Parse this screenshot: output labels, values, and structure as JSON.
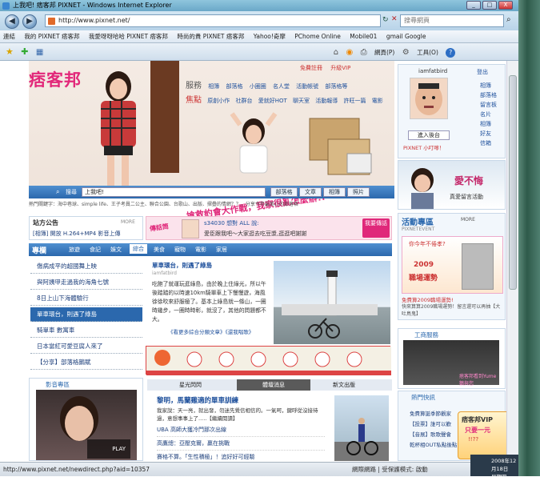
{
  "window": {
    "title": "上我吧! 痞客邦 PIXNET - Windows Internet Explorer",
    "min": "_",
    "max": "□",
    "close": "X"
  },
  "address": {
    "url": "http://www.pixnet.net/",
    "search_placeholder": "搜尋網頁"
  },
  "favorites": [
    "連結",
    "我的 PIXNET 痞客邦",
    "我愛呀呀哈哈 PIXNET 痞客邦",
    "時尚的貴 PIXNET 痞客邦",
    "Yahoo!奇摩",
    "PChome Online",
    "Mobile01",
    "gmail Google"
  ],
  "toolbar": {
    "page": "網頁(P)",
    "tools": "工具(O)",
    "help": "?"
  },
  "header": {
    "logo": "痞客邦",
    "top_links": [
      "免費註冊",
      "升級VIP"
    ],
    "cat1": "服務",
    "cat1_items": [
      "相簿",
      "部落格",
      "小圈圈",
      "名人堂",
      "活動帳號",
      "部落格等"
    ],
    "cat2": "焦點",
    "cat2_items": [
      "原創小作",
      "社群台",
      "愛就好HOT",
      "聊天室",
      "活動報導",
      "許旺一篇",
      "電影"
    ],
    "banner_text": "搶救約會大作戰，我家很亂怎麼辦!!",
    "search_label": "搜尋",
    "search_value": "上我吧!",
    "search_tabs": [
      "部落格",
      "文章",
      "相簿",
      "照片"
    ],
    "hot_keywords": "熱門關鍵字：海中巷球、simple life、王子考員二公主、聯合公園、台歌山、出版、摺疊的情網？？、分享今年最美心的部落格"
  },
  "user": {
    "name": "iamfatbird",
    "logout": "登出",
    "menu": [
      "相簿",
      "部落格",
      "留言板",
      "名片",
      "相簿",
      "好友",
      "信箱"
    ],
    "backend": "進入後台",
    "vip": "PIXNET 小叮嚀！"
  },
  "announce": {
    "title": "站方公告",
    "more": "MORE",
    "text": "[相簿] 開放 H.264+MP4 影音上傳"
  },
  "ad_strip": {
    "label": "傳話筒",
    "user": "s34030 想對 ALL 說:",
    "msg": "愛臣跟我吧～大家逛去吃豆漿,逛逛吧謝謝",
    "btn": "我要傳話"
  },
  "column": {
    "tab": "專欄",
    "subtabs": [
      "旅遊",
      "食記",
      "娛文",
      "綜合",
      "美食",
      "寵物",
      "電影",
      "家居"
    ],
    "items": [
      "傷病成平的超國舞上映",
      "與阿姨甲走過我的海角七號",
      "8日上山下海體驗行",
      "單車環台，則遇了綠島",
      "騎單車 數寓車",
      "日本當紅可愛豆腐人來了",
      "【分享】部落格鵝賦"
    ],
    "article_title": "單車環台，則遇了綠島",
    "article_author": "iamfatbird",
    "article_body": "吃飽了就運玩逛綠島，由於晚上住綠光，所以午後踏踏的以時速10km騎單車上下慢慢遊，海風徐徐吹來舒服極了。基本上綠島就一條山，一圈時幾步，一圈時時彰，就沒了，其他的問題都不大。",
    "article_more": "《看更多綜合分類文章》《還我唱歌》"
  },
  "activity": {
    "title": "活動專區",
    "more": "MORE",
    "event": "PIXNETEVENT",
    "ad1": "愛不悔",
    "ad1_sub": "真愛留言活動",
    "ad2_title": "你今年不倦孝?",
    "ad2_year": "2009",
    "ad2_big": "職場運勢",
    "ad2_caption": "免費算2009職場運勢!",
    "ad3": "快來算算2009職場運勢！留言還可以再抽【大吐鳥鬼】"
  },
  "service": {
    "title": "工商服務",
    "ad": "痞客邦看到Yume鵝與您"
  },
  "video": {
    "title": "影音專區",
    "play": "PLAY"
  },
  "news": {
    "tabs": [
      "星光閃閃",
      "體壇消息",
      "新文出版"
    ],
    "headline": "黎明，馬蘭雞適的單車訓練",
    "body": "我家說：天一亮，就出發，勿迷先覺信相信的。一氣呵，鍵呼從沒接待過，意想事事上了.....【繼續閱讀】",
    "items": [
      "UBA 高師大獲冷門那次出線",
      "高鷹總：亞壓克爾，贏在挑戰",
      "賽格不算。「生性積極」！追好好可經驗"
    ]
  },
  "hot": {
    "title": "熱門快訊",
    "items": [
      "免費算誕季節觀家",
      "【投票】誰可以歡",
      "【音展】歌歌聲會",
      "乾杯相OUT私點後點"
    ]
  },
  "vip_badge": {
    "line1": "痞客邦VIP",
    "line2": "只要一元",
    "line3": "!!??"
  },
  "status": {
    "url": "http://www.pixnet.net/newdirect.php?aid=10357",
    "zone": "網際網路 | 受保護模式: 啟動",
    "date": "2008年12月18日",
    "weekday": "星期四"
  },
  "colors": {
    "pink": "#e2287a",
    "blue": "#2b68ad",
    "ie_frame": "#6aa8c8"
  }
}
